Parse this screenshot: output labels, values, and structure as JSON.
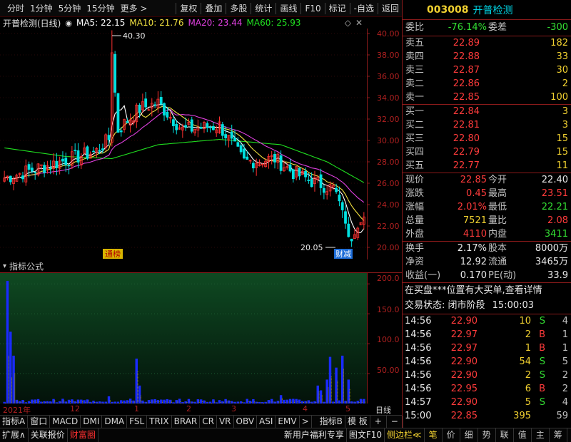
{
  "toolbar": {
    "left": [
      "分时",
      "1分钟",
      "5分钟",
      "15分钟",
      "更多 >"
    ],
    "right": [
      "复权",
      "叠加",
      "多股",
      "统计",
      "画线",
      "F10",
      "标记",
      "-自选",
      "返回"
    ]
  },
  "chart_title": {
    "name": "开普检测(日线)",
    "ma5": "MA5: 22.15",
    "ma10": "MA10: 21.76",
    "ma20": "MA20: 23.44",
    "ma60": "MA60: 25.93"
  },
  "colors": {
    "ma5": "#ffffff",
    "ma10": "#f0e040",
    "ma20": "#e040e0",
    "ma60": "#20e020",
    "up": "#ff3030",
    "down": "#00e0e0",
    "volume": "#1a2bff"
  },
  "price_axis": [
    "40.00",
    "38.00",
    "36.00",
    "34.00",
    "32.00",
    "30.00",
    "28.00",
    "26.00",
    "24.00",
    "22.00",
    "20.00"
  ],
  "price_marks": {
    "high": "40.30",
    "low": "20.05"
  },
  "badges": {
    "left": "通榜",
    "right": "财减"
  },
  "indicator": {
    "label": "指标公式",
    "axis": [
      "200.0",
      "150.0",
      "100.0",
      "50.00"
    ]
  },
  "date_axis": {
    "year": "2021年",
    "months": [
      "12",
      "1",
      "2",
      "3",
      "4",
      "5"
    ],
    "period": "日线"
  },
  "tabs_row1": [
    "指标A",
    "窗口",
    "MACD",
    "DMI",
    "DMA",
    "FSL",
    "TRIX",
    "BRAR",
    "CR",
    "VR",
    "OBV",
    "ASI",
    "EMV",
    ">",
    "指标B",
    "模 板",
    "+",
    "−"
  ],
  "tabs_row2": {
    "left": [
      "扩展∧",
      "关联报价",
      "财富圈"
    ],
    "mid": [
      "新用户福利专享",
      "图文F10",
      "侧边栏≪"
    ],
    "right": [
      "笔",
      "价",
      "细",
      "势",
      "联",
      "值",
      "主",
      "筹"
    ]
  },
  "quote": {
    "code": "003008",
    "name": "开普检测",
    "weibi_label": "委比",
    "weibi": "-76.14%",
    "weicha_label": "委差",
    "weicha": "-300",
    "asks": [
      {
        "label": "卖五",
        "price": "22.89",
        "vol": "182"
      },
      {
        "label": "卖四",
        "price": "22.88",
        "vol": "33"
      },
      {
        "label": "卖三",
        "price": "22.87",
        "vol": "30"
      },
      {
        "label": "卖二",
        "price": "22.86",
        "vol": "2"
      },
      {
        "label": "卖一",
        "price": "22.85",
        "vol": "100"
      }
    ],
    "bids": [
      {
        "label": "买一",
        "price": "22.84",
        "vol": "3"
      },
      {
        "label": "买二",
        "price": "22.81",
        "vol": "3"
      },
      {
        "label": "买三",
        "price": "22.80",
        "vol": "15"
      },
      {
        "label": "买四",
        "price": "22.79",
        "vol": "15"
      },
      {
        "label": "买五",
        "price": "22.77",
        "vol": "11"
      }
    ],
    "stats": [
      {
        "l1": "现价",
        "v1": "22.85",
        "l2": "今开",
        "v2": "22.40"
      },
      {
        "l1": "涨跌",
        "v1": "0.45",
        "l2": "最高",
        "v2": "23.51"
      },
      {
        "l1": "涨幅",
        "v1": "2.01%",
        "l2": "最低",
        "v2": "22.21"
      },
      {
        "l1": "总量",
        "v1": "7521",
        "l2": "量比",
        "v2": "2.08"
      },
      {
        "l1": "外盘",
        "v1": "4110",
        "l2": "内盘",
        "v2": "3411"
      }
    ],
    "fund": [
      {
        "l1": "换手",
        "v1": "2.17%",
        "l2": "股本",
        "v2": "8000万"
      },
      {
        "l1": "净资",
        "v1": "12.92",
        "l2": "流通",
        "v2": "3465万"
      },
      {
        "l1": "收益(一)",
        "v1": "0.170",
        "l2": "PE(动)",
        "v2": "33.9"
      }
    ],
    "notice": "在买盘***位置有大买单,查看详情",
    "trade_status_label": "交易状态: 闭市阶段",
    "trade_status_time": "15:00:03",
    "ticks": [
      {
        "t": "14:56",
        "p": "22.90",
        "v": "10",
        "d": "S",
        "n": "4"
      },
      {
        "t": "14:56",
        "p": "22.97",
        "v": "2",
        "d": "B",
        "n": "1"
      },
      {
        "t": "14:56",
        "p": "22.97",
        "v": "1",
        "d": "B",
        "n": "1"
      },
      {
        "t": "14:56",
        "p": "22.90",
        "v": "54",
        "d": "S",
        "n": "5"
      },
      {
        "t": "14:56",
        "p": "22.90",
        "v": "2",
        "d": "S",
        "n": "2"
      },
      {
        "t": "14:56",
        "p": "22.95",
        "v": "6",
        "d": "B",
        "n": "2"
      },
      {
        "t": "14:57",
        "p": "22.90",
        "v": "5",
        "d": "S",
        "n": "4"
      },
      {
        "t": "15:00",
        "p": "22.85",
        "v": "395",
        "d": "",
        "n": "59"
      }
    ]
  }
}
